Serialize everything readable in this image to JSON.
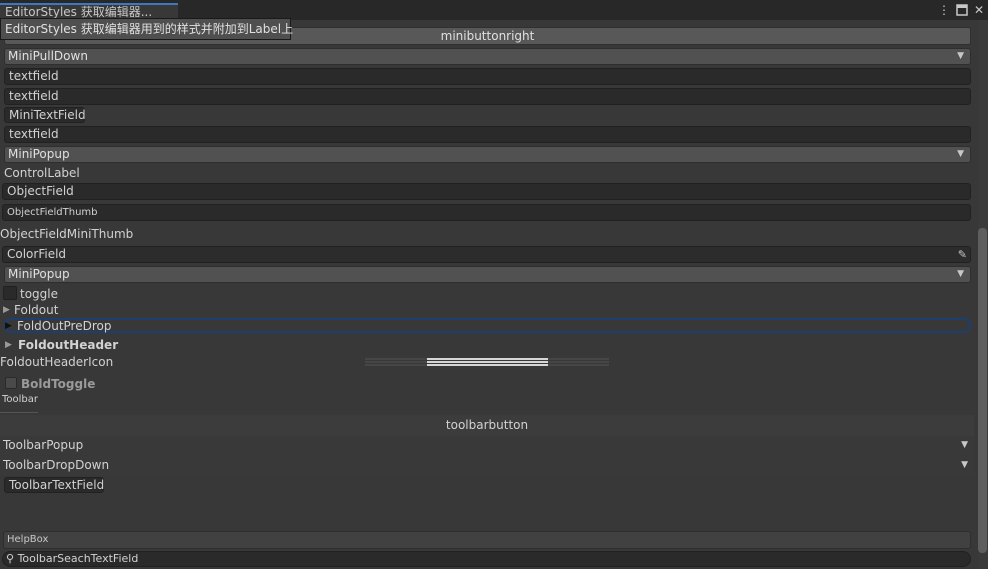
{
  "window": {
    "tab_title": "EditorStyles 获取编辑器...",
    "tooltip": "EditorStyles 获取编辑器用到的样式并附加到Label上"
  },
  "icons": {
    "kebab": "⋮",
    "maximize": "□",
    "close": "✕",
    "caret": "▼",
    "foldout": "▶",
    "eyedropper": "✎",
    "search": "⚲"
  },
  "controls": {
    "minibuttonright": "minibuttonright",
    "minipulldown": "MiniPullDown",
    "textfield1": "textfield",
    "textfield2": "textfield",
    "minitextfield": "MiniTextField",
    "textfield3": "textfield",
    "minipopup1": "MiniPopup",
    "controllabel": "ControlLabel",
    "objectfield": "ObjectField",
    "objectfieldthumb": "ObjectFieldThumb",
    "objectfieldminithumb": "ObjectFieldMiniThumb",
    "colorfield": "ColorField",
    "minipopup2": "MiniPopup",
    "toggle": "toggle",
    "foldout": "Foldout",
    "foldoutpredrop": "FoldOutPreDrop",
    "foldoutheader": "FoldoutHeader",
    "foldoutheadericon": "FoldoutHeaderIcon",
    "boldtoggle": "BoldToggle",
    "toolbar": "Toolbar",
    "toolbarbutton": "toolbarbutton",
    "toolbarpopup": "ToolbarPopup",
    "toolbardropdown": "ToolbarDropDown",
    "toolbartextfield": "ToolbarTextField",
    "helpbox": "HelpBox",
    "toolbarsearchtextfield": "ToolbarSeachTextField"
  },
  "colors": {
    "background": "#383838",
    "accent": "#3a79bb",
    "focus_ring": "#1d3f70"
  }
}
